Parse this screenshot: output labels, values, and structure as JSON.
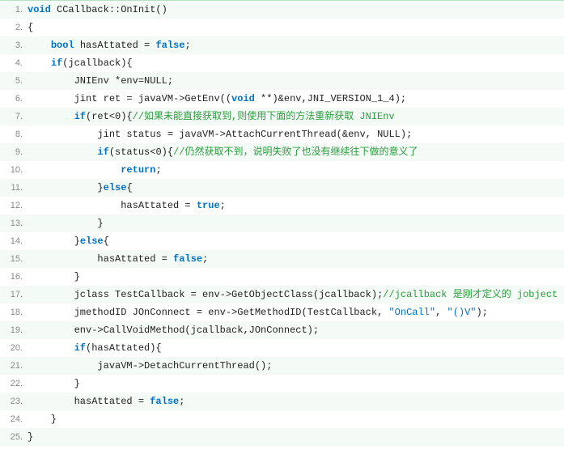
{
  "lines": [
    {
      "num": "1.",
      "hl": true,
      "tokens": [
        [
          "kw",
          "void"
        ],
        [
          "plain",
          " CCallback::OnInit()"
        ]
      ]
    },
    {
      "num": "2.",
      "hl": false,
      "tokens": [
        [
          "plain",
          "{"
        ]
      ]
    },
    {
      "num": "3.",
      "hl": true,
      "tokens": [
        [
          "plain",
          "    "
        ],
        [
          "kw",
          "bool"
        ],
        [
          "plain",
          " hasAttated = "
        ],
        [
          "kw",
          "false"
        ],
        [
          "plain",
          ";"
        ]
      ]
    },
    {
      "num": "4.",
      "hl": false,
      "tokens": [
        [
          "plain",
          "    "
        ],
        [
          "kw",
          "if"
        ],
        [
          "plain",
          "(jcallback){"
        ]
      ]
    },
    {
      "num": "5.",
      "hl": true,
      "tokens": [
        [
          "plain",
          "        JNIEnv *env=NULL;"
        ]
      ]
    },
    {
      "num": "6.",
      "hl": false,
      "tokens": [
        [
          "plain",
          "        jint ret = javaVM->GetEnv(("
        ],
        [
          "kw",
          "void"
        ],
        [
          "plain",
          " **)&env,JNI_VERSION_1_4);"
        ]
      ]
    },
    {
      "num": "7.",
      "hl": true,
      "tokens": [
        [
          "plain",
          "        "
        ],
        [
          "kw",
          "if"
        ],
        [
          "plain",
          "(ret<0){"
        ],
        [
          "cmt",
          "//如果未能直接获取到,则使用下面的方法重新获取 JNIEnv"
        ]
      ]
    },
    {
      "num": "8.",
      "hl": false,
      "tokens": [
        [
          "plain",
          "            jint status = javaVM->AttachCurrentThread(&env, NULL);"
        ]
      ]
    },
    {
      "num": "9.",
      "hl": true,
      "tokens": [
        [
          "plain",
          "            "
        ],
        [
          "kw",
          "if"
        ],
        [
          "plain",
          "(status<0){"
        ],
        [
          "cmt",
          "//仍然获取不到，说明失败了也没有继续往下做的意义了"
        ]
      ]
    },
    {
      "num": "10.",
      "hl": false,
      "tokens": [
        [
          "plain",
          "                "
        ],
        [
          "kw",
          "return"
        ],
        [
          "plain",
          ";"
        ]
      ]
    },
    {
      "num": "11.",
      "hl": true,
      "tokens": [
        [
          "plain",
          "            }"
        ],
        [
          "kw",
          "else"
        ],
        [
          "plain",
          "{"
        ]
      ]
    },
    {
      "num": "12.",
      "hl": false,
      "tokens": [
        [
          "plain",
          "                hasAttated = "
        ],
        [
          "kw",
          "true"
        ],
        [
          "plain",
          ";"
        ]
      ]
    },
    {
      "num": "13.",
      "hl": true,
      "tokens": [
        [
          "plain",
          "            }"
        ]
      ]
    },
    {
      "num": "14.",
      "hl": false,
      "tokens": [
        [
          "plain",
          "        }"
        ],
        [
          "kw",
          "else"
        ],
        [
          "plain",
          "{"
        ]
      ]
    },
    {
      "num": "15.",
      "hl": true,
      "tokens": [
        [
          "plain",
          "            hasAttated = "
        ],
        [
          "kw",
          "false"
        ],
        [
          "plain",
          ";"
        ]
      ]
    },
    {
      "num": "16.",
      "hl": false,
      "tokens": [
        [
          "plain",
          "        }"
        ]
      ]
    },
    {
      "num": "17.",
      "hl": true,
      "tokens": [
        [
          "plain",
          "        jclass TestCallback = env->GetObjectClass(jcallback);"
        ],
        [
          "cmt",
          "//jcallback 是刚才定义的 jobject 全局变量"
        ]
      ]
    },
    {
      "num": "18.",
      "hl": false,
      "tokens": [
        [
          "plain",
          "        jmethodID JOnConnect = env->GetMethodID(TestCallback, "
        ],
        [
          "str",
          "\"OnCall\""
        ],
        [
          "plain",
          ", "
        ],
        [
          "str",
          "\"()V\""
        ],
        [
          "plain",
          ");"
        ]
      ]
    },
    {
      "num": "19.",
      "hl": true,
      "tokens": [
        [
          "plain",
          "        env->CallVoidMethod(jcallback,JOnConnect);"
        ]
      ]
    },
    {
      "num": "20.",
      "hl": false,
      "tokens": [
        [
          "plain",
          "        "
        ],
        [
          "kw",
          "if"
        ],
        [
          "plain",
          "(hasAttated){"
        ]
      ]
    },
    {
      "num": "21.",
      "hl": true,
      "tokens": [
        [
          "plain",
          "            javaVM->DetachCurrentThread();"
        ]
      ]
    },
    {
      "num": "22.",
      "hl": false,
      "tokens": [
        [
          "plain",
          "        }"
        ]
      ]
    },
    {
      "num": "23.",
      "hl": true,
      "tokens": [
        [
          "plain",
          "        hasAttated = "
        ],
        [
          "kw",
          "false"
        ],
        [
          "plain",
          ";"
        ]
      ]
    },
    {
      "num": "24.",
      "hl": false,
      "tokens": [
        [
          "plain",
          "    }"
        ]
      ]
    },
    {
      "num": "25.",
      "hl": true,
      "tokens": [
        [
          "plain",
          "}"
        ]
      ]
    }
  ]
}
